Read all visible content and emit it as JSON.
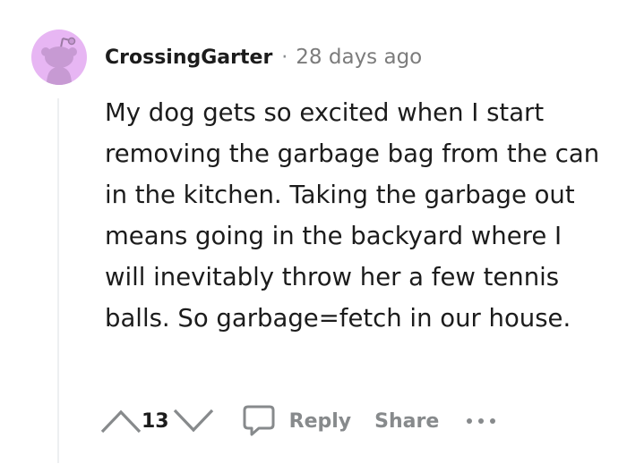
{
  "comment": {
    "avatar_icon": "snoo-avatar-icon",
    "avatar_color": "#e7b6f3",
    "username": "CrossingGarter",
    "separator": "·",
    "timestamp": "28 days ago",
    "body": "My dog gets so excited when I start removing the garbage bag from the can in the kitchen. Taking the garbage out means going in the backyard where I will inevitably throw her a few tennis balls. So garbage=fetch in our house."
  },
  "actions": {
    "upvote_icon": "upvote-arrow-icon",
    "score": "13",
    "downvote_icon": "downvote-arrow-icon",
    "reply_icon": "speech-bubble-icon",
    "reply_label": "Reply",
    "share_label": "Share",
    "more_icon": "ellipsis-icon"
  },
  "colors": {
    "text": "#1c1c1c",
    "muted": "#878a8c",
    "thread_line": "#edeff1"
  }
}
